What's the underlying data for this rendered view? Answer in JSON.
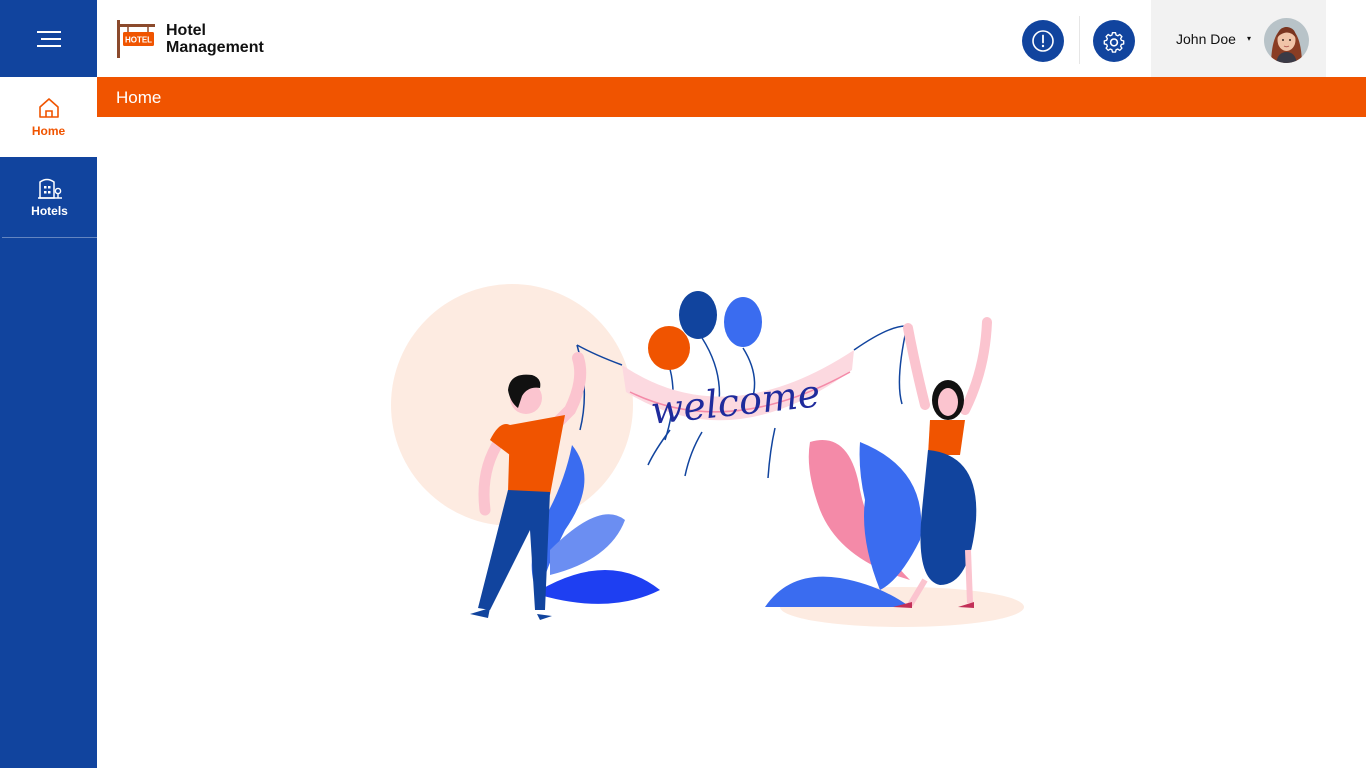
{
  "app": {
    "title_line1": "Hotel",
    "title_line2": "Management",
    "logo_sign_text": "HOTEL"
  },
  "sidebar": {
    "menu_icon": "hamburger-icon",
    "items": [
      {
        "label": "Home",
        "icon": "home-icon",
        "active": true
      },
      {
        "label": "Hotels",
        "icon": "hotel-building-icon",
        "active": false
      }
    ]
  },
  "header": {
    "alert_icon": "alert-icon",
    "settings_icon": "gear-icon",
    "user": {
      "name": "John Doe",
      "caret": "▾",
      "avatar": "avatar"
    }
  },
  "breadcrumb": {
    "current": "Home"
  },
  "main": {
    "illustration": {
      "banner_text": "welcome"
    }
  },
  "colors": {
    "primary": "#11449e",
    "accent": "#f05400",
    "user_box_bg": "#f2f2f2"
  }
}
